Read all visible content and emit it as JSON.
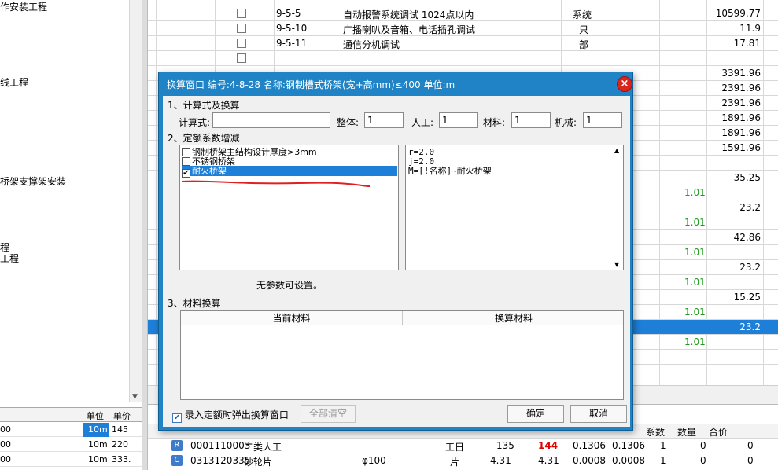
{
  "left_tree": {
    "items": [
      "作安装工程",
      "线工程",
      "桥架支撑架安装",
      "程",
      "工程"
    ]
  },
  "left_bottom": {
    "headers": [
      "单位",
      "单价"
    ],
    "rows": [
      {
        "code": "00",
        "unit": "10m",
        "price": "145"
      },
      {
        "code": "00",
        "unit": "10m",
        "price": "220"
      },
      {
        "code": "00",
        "unit": "10m",
        "price": "333."
      }
    ]
  },
  "main_grid": {
    "rows": [
      {
        "code": "9-5-5",
        "name": "自动报警系统调试 1024点以内",
        "unit": "系统",
        "value": "10599.77"
      },
      {
        "code": "9-5-10",
        "name": "广播喇叭及音箱、电话插孔调试",
        "unit": "只",
        "value": "11.9"
      },
      {
        "code": "9-5-11",
        "name": "通信分机调试",
        "unit": "部",
        "value": "17.81"
      }
    ],
    "values": [
      "3391.96",
      "2391.96",
      "2391.96",
      "1891.96",
      "1891.96",
      "1591.96",
      "35.25",
      "23.2",
      "42.86",
      "23.2",
      "15.25",
      "23.2"
    ],
    "coef": [
      "1.01",
      "1.01",
      "1.01",
      "1.01",
      "1.01",
      "1.01"
    ]
  },
  "detail_grid": {
    "headers": [
      "系数",
      "数量",
      "合价"
    ],
    "rows": [
      {
        "type": "R",
        "code": "0001110003",
        "name": "二类人工",
        "spec": "",
        "unit": "工日",
        "price1": "135",
        "price2": "144",
        "qty1": "0.1306",
        "qty2": "0.1306",
        "coef": "1",
        "amount": "0",
        "total": "0"
      },
      {
        "type": "C",
        "code": "0313120335",
        "name": "砂轮片",
        "spec": "φ100",
        "unit": "片",
        "price1": "4.31",
        "price2": "4.31",
        "qty1": "0.0008",
        "qty2": "0.0008",
        "coef": "1",
        "amount": "0",
        "total": "0"
      }
    ]
  },
  "dialog": {
    "title": "换算窗口 编号:4-8-28 名称:钢制槽式桥架(宽+高mm)≤400 单位:m",
    "close_icon": "×",
    "section1": "1、计算式及换算",
    "calc_label": "计算式:",
    "calc_value": "",
    "whole_label": "整体:",
    "whole_value": "1",
    "labor_label": "人工:",
    "labor_value": "1",
    "material_label": "材料:",
    "material_value": "1",
    "machine_label": "机械:",
    "machine_value": "1",
    "section2": "2、定额系数增减",
    "coef_items": [
      {
        "label": "钢制桥架主结构设计厚度>3mm",
        "checked": false
      },
      {
        "label": "不锈钢桥架",
        "checked": false
      },
      {
        "label": "耐火桥架",
        "checked": true
      }
    ],
    "formula_lines": [
      "r=2.0",
      "j=2.0",
      "M=[!名称]~耐火桥架"
    ],
    "no_params": "无参数可设置。",
    "section3": "3、材料换算",
    "material_headers": [
      "当前材料",
      "换算材料"
    ],
    "popup_checkbox_label": "录入定额时弹出换算窗口",
    "popup_checked": true,
    "clear_all": "全部清空",
    "ok": "确定",
    "cancel": "取消"
  }
}
